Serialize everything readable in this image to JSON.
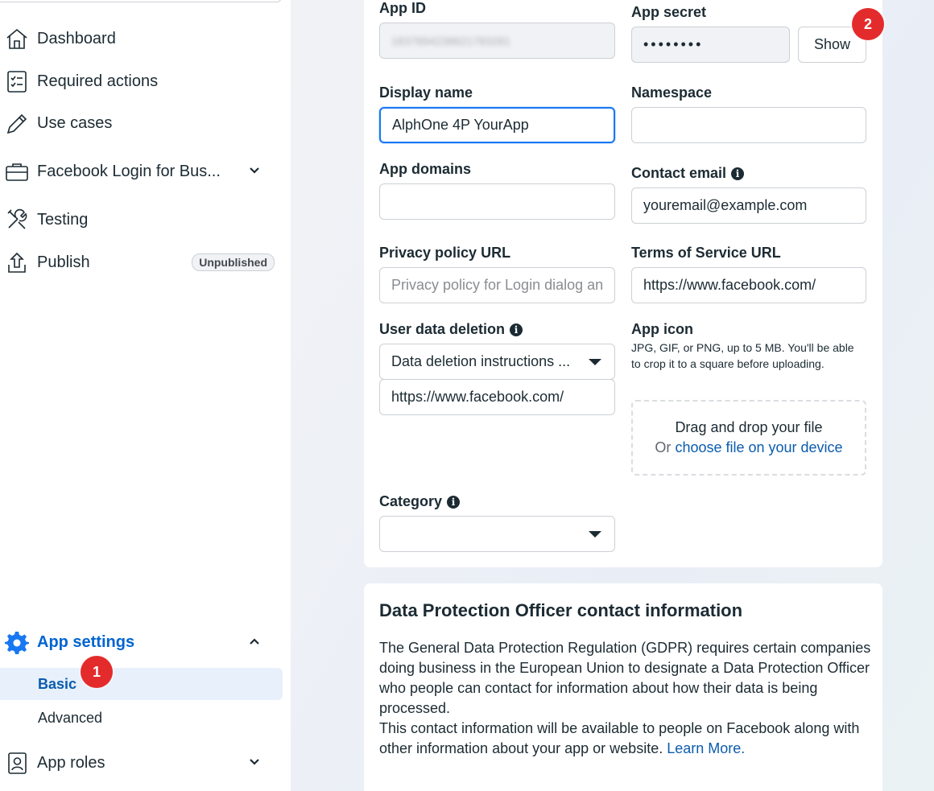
{
  "sidebar": {
    "items": [
      {
        "label": "Dashboard"
      },
      {
        "label": "Required actions"
      },
      {
        "label": "Use cases"
      },
      {
        "label": "Facebook Login for Bus..."
      },
      {
        "label": "Testing"
      },
      {
        "label": "Publish",
        "badge": "Unpublished"
      }
    ],
    "settings": {
      "label": "App settings",
      "sub": [
        {
          "label": "Basic"
        },
        {
          "label": "Advanced"
        }
      ]
    },
    "roles": {
      "label": "App roles"
    }
  },
  "markers": {
    "one": "1",
    "two": "2"
  },
  "form": {
    "app_id": {
      "label": "App ID",
      "value": "1837894238621783281"
    },
    "app_secret": {
      "label": "App secret",
      "value": "••••••••",
      "show": "Show"
    },
    "display_name": {
      "label": "Display name",
      "value": "AlphOne 4P YourApp"
    },
    "namespace": {
      "label": "Namespace",
      "value": ""
    },
    "app_domains": {
      "label": "App domains",
      "value": ""
    },
    "contact_email": {
      "label": "Contact email",
      "value": "youremail@example.com"
    },
    "privacy_url": {
      "label": "Privacy policy URL",
      "placeholder": "Privacy policy for Login dialog an"
    },
    "tos_url": {
      "label": "Terms of Service URL",
      "value": "https://www.facebook.com/"
    },
    "data_deletion": {
      "label": "User data deletion",
      "select": "Data deletion instructions ...",
      "value": "https://www.facebook.com/"
    },
    "app_icon": {
      "label": "App icon",
      "help": "JPG, GIF, or PNG, up to 5 MB. You'll be able to crop it to a square before uploading.",
      "drop_title": "Drag and drop your file",
      "drop_or": "Or",
      "drop_link": "choose file on your device"
    },
    "category": {
      "label": "Category",
      "value": ""
    }
  },
  "dpo": {
    "title": "Data Protection Officer contact information",
    "p1": "The General Data Protection Regulation (GDPR) requires certain companies doing business in the European Union to designate a Data Protection Officer who people can contact for information about how their data is being processed.",
    "p2": "This contact information will be available to people on Facebook along with other information about your app or website.",
    "learn_more": "Learn More."
  }
}
